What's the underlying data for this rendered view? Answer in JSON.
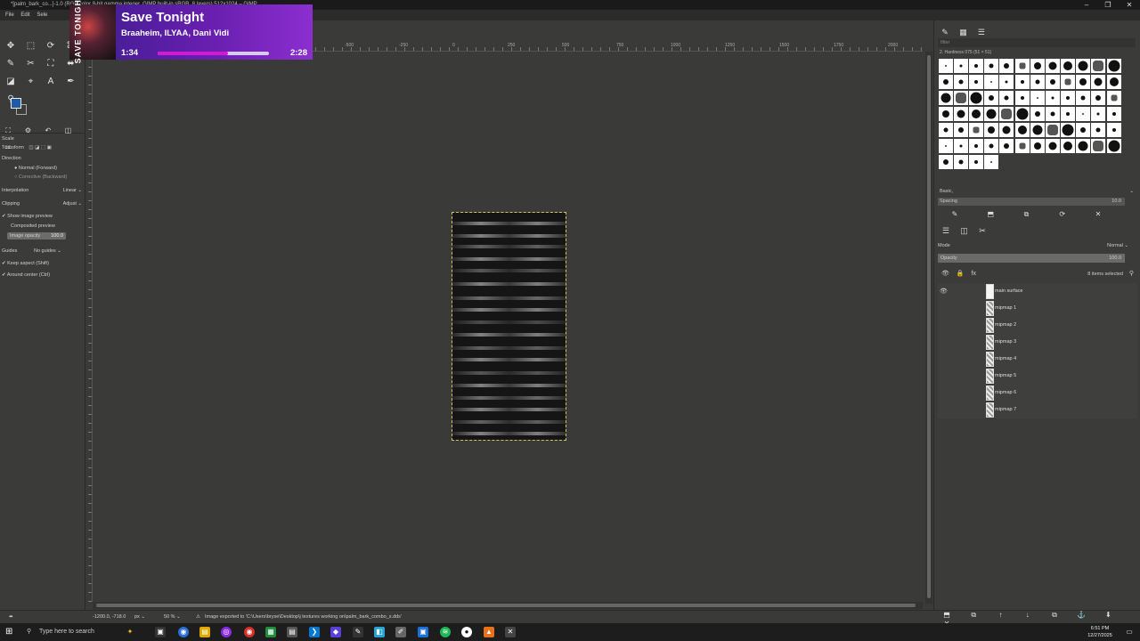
{
  "window": {
    "title": "*[palm_bark_co...]-1.0 (RGB color 8-bit gamma integer, GIMP built-in sRGB, 8 layers) 512x1024 – GIMP",
    "controls": [
      "–",
      "❐",
      "✕"
    ]
  },
  "menubar": [
    "File",
    "Edit",
    "Sele"
  ],
  "toolbox": {
    "tools": [
      "✥",
      "⬚",
      "⟳",
      "⌘",
      "✎",
      "✂",
      "⛶",
      "⬌",
      "◪",
      "⌖",
      "A",
      "✒",
      "⚲"
    ],
    "options_tabs": [
      "⛶",
      "⚙",
      "↶",
      "◫",
      "⚏"
    ],
    "tool_name": "Scale",
    "transform_label": "Transform",
    "direction_label": "Direction",
    "direction_normal": "Normal (Forward)",
    "direction_corrective": "Corrective (Backward)",
    "interpolation_label": "Interpolation",
    "interpolation_value": "Linear",
    "clipping_label": "Clipping",
    "clipping_value": "Adjust",
    "show_preview": "Show image preview",
    "composited_preview": "Composited preview",
    "image_opacity_label": "Image opacity",
    "image_opacity_value": "100.0",
    "image_opacity_fraction": 1.0,
    "guides_label": "Guides",
    "guides_value": "No guides",
    "keep_aspect": "Keep aspect (Shift)",
    "around_center": "Around center (Ctrl)",
    "fg_color": "#1d5ba8"
  },
  "rulers": {
    "h_labels": [
      "-500",
      "-250",
      "0",
      "250",
      "500",
      "750",
      "1000",
      "1250",
      "1500",
      "1750",
      "2000"
    ],
    "v_labels": [
      "0",
      "250",
      "500",
      "750",
      "1000"
    ]
  },
  "status": {
    "coords": "-1200.0, -718.0",
    "unit": "px",
    "zoom": "50 %",
    "message": "Image exported to 'C:\\Users\\bryse\\Desktop\\j textures working on\\palm_bark_combo_s.dds'"
  },
  "brushes": {
    "filter_placeholder": "filter",
    "current": "2. Hardness 075 (51 × 51)",
    "tag": "Basic,",
    "spacing_label": "Spacing",
    "spacing_value": "10.0",
    "dock_icons": [
      "✎",
      "⬒",
      "⧉",
      "⟳",
      "✕"
    ]
  },
  "layers": {
    "tabs": [
      "☰",
      "◫",
      "✂"
    ],
    "mode_label": "Mode",
    "mode_value": "Normal",
    "opacity_label": "Opacity",
    "opacity_value": "100.0",
    "opacity_fraction": 1.0,
    "selected": "8 items selected",
    "items": [
      {
        "name": "main surface",
        "visible": true,
        "thumb": "white"
      },
      {
        "name": "mipmap 1",
        "visible": false,
        "thumb": "pattern"
      },
      {
        "name": "mipmap 2",
        "visible": false,
        "thumb": "pattern"
      },
      {
        "name": "mipmap 3",
        "visible": false,
        "thumb": "pattern"
      },
      {
        "name": "mipmap 4",
        "visible": false,
        "thumb": "pattern"
      },
      {
        "name": "mipmap 5",
        "visible": false,
        "thumb": "pattern"
      },
      {
        "name": "mipmap 6",
        "visible": false,
        "thumb": "pattern"
      },
      {
        "name": "mipmap 7",
        "visible": false,
        "thumb": "pattern"
      }
    ],
    "bottom_icons": [
      "⬒",
      "⧉",
      "↑",
      "↓",
      "⧉",
      "⚓",
      "⬇",
      "✕"
    ]
  },
  "music": {
    "tag": "SAVE TONIGHT",
    "title": "Save Tonight",
    "artist": "Braaheim, ILYAA, Dani Vidi",
    "current": "1:34",
    "total": "2:28",
    "progress_fraction": 0.635
  },
  "taskbar": {
    "search_placeholder": "Type here to search",
    "time": "6:51 PM",
    "date": "12/27/2025"
  }
}
